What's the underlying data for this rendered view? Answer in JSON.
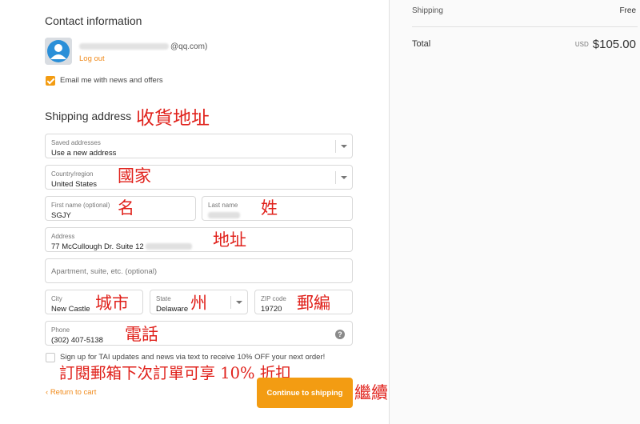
{
  "contact": {
    "title": "Contact information",
    "email_domain": "@qq.com)",
    "logout": "Log out",
    "newsletter_label": "Email me with news and offers"
  },
  "shipping": {
    "title": "Shipping address",
    "saved": {
      "label": "Saved addresses",
      "value": "Use a new address"
    },
    "country": {
      "label": "Country/region",
      "value": "United States"
    },
    "first_name": {
      "label": "First name (optional)",
      "value": "SGJY"
    },
    "last_name": {
      "label": "Last name"
    },
    "address": {
      "label": "Address",
      "value": "77 McCullough Dr. Suite 12"
    },
    "apartment": {
      "placeholder": "Apartment, suite, etc. (optional)"
    },
    "city": {
      "label": "City",
      "value": "New Castle"
    },
    "state": {
      "label": "State",
      "value": "Delaware"
    },
    "zip": {
      "label": "ZIP code",
      "value": "19720"
    },
    "phone": {
      "label": "Phone",
      "value": "(302) 407-5138",
      "help": "?"
    },
    "sms_label": "Sign up for TAI updates and news via text to receive 10% OFF your next order!"
  },
  "actions": {
    "return_label": "Return to cart",
    "continue_label": "Continue to shipping"
  },
  "summary": {
    "shipping_label": "Shipping",
    "shipping_value": "Free",
    "total_label": "Total",
    "currency": "USD",
    "total_value": "$105.00"
  },
  "annotations": {
    "shipping_address": "收貨地址",
    "country": "國家",
    "first_name": "名",
    "last_name": "姓",
    "address": "地址",
    "city": "城市",
    "state": "州",
    "zip": "郵編",
    "phone": "電話",
    "sms": "訂閱郵箱下次訂單可享 10% 折扣",
    "continue": "繼續"
  },
  "colors": {
    "accent": "#f39c12",
    "annotation": "#e0211b"
  }
}
